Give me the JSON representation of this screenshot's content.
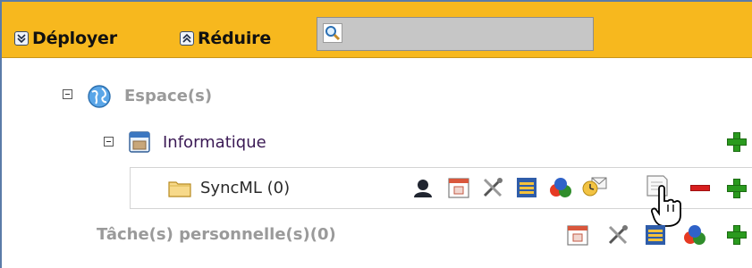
{
  "toolbar": {
    "expand_label": "Déployer",
    "collapse_label": "Réduire",
    "search_value": ""
  },
  "tree": {
    "root_label": "Espace(s)",
    "space_label": "Informatique",
    "folder_label": "SyncML (0)",
    "personal_tasks_label": "Tâche(s) personnelle(s)(0)"
  },
  "icons": {
    "expand": "expand-double-chevron-icon",
    "collapse": "collapse-double-chevron-icon",
    "search": "magnifier-icon",
    "globe": "globe-icon",
    "space": "window-icon",
    "folder": "folder-icon",
    "row_actions": [
      "person-icon",
      "calendar-icon",
      "tools-icon",
      "list-icon",
      "shapes-icon",
      "alarm-email-icon",
      "note-icon",
      "minus-icon",
      "plus-icon"
    ],
    "task_actions": [
      "calendar-icon",
      "tools-icon",
      "list-icon",
      "shapes-icon",
      "plus-icon"
    ]
  },
  "colors": {
    "toolbar_bg": "#f7b81e",
    "tree_label_gray": "#9a9a9a",
    "space_label": "#3b1a55",
    "add_green": "#2a9a1e",
    "remove_red": "#d71e1e"
  }
}
